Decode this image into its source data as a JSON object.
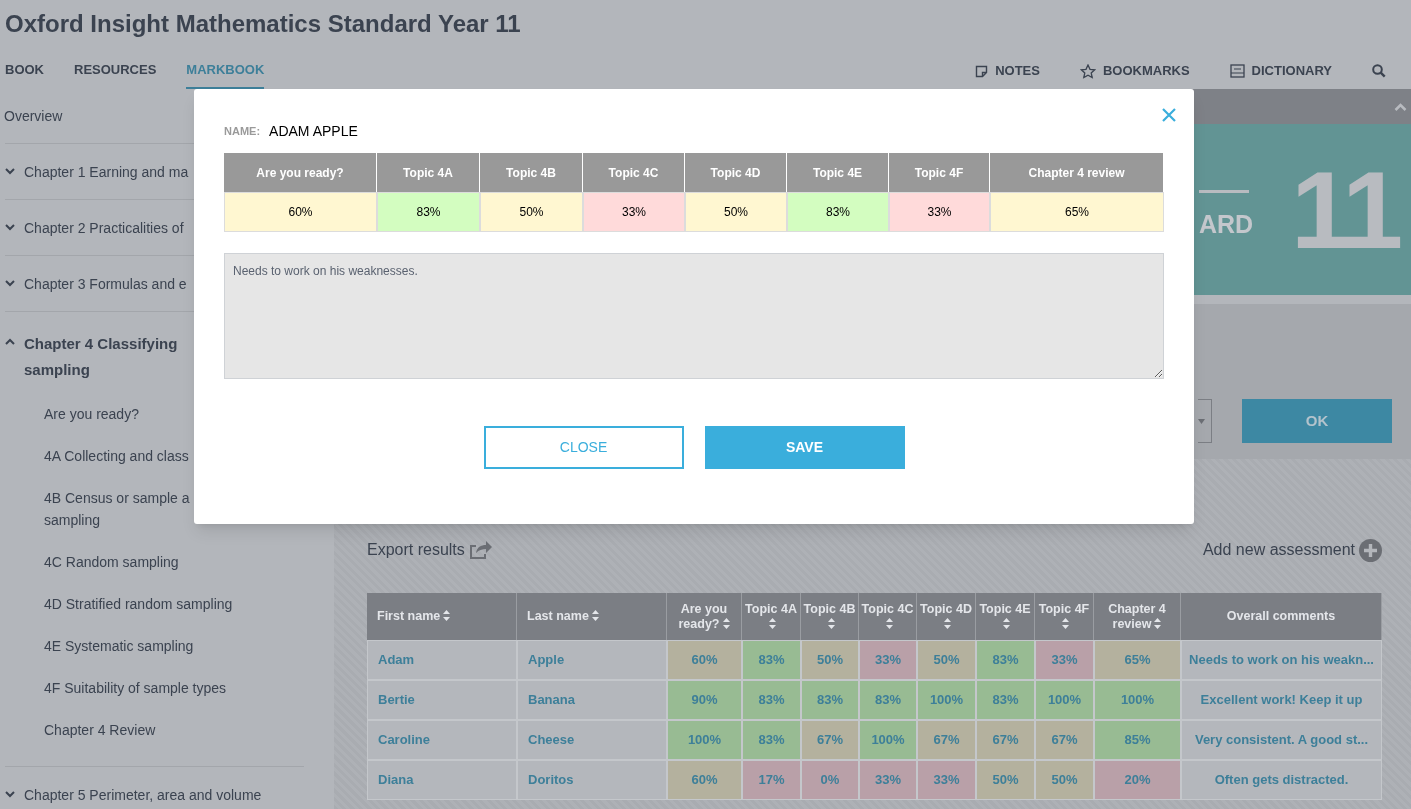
{
  "title": "Oxford Insight Mathematics Standard Year 11",
  "tabs": [
    {
      "label": "BOOK",
      "selected": false
    },
    {
      "label": "RESOURCES",
      "selected": false
    },
    {
      "label": "MARKBOOK",
      "selected": true
    }
  ],
  "tools": [
    {
      "label": "NOTES",
      "kind": "notes"
    },
    {
      "label": "BOOKMARKS",
      "kind": "bookmarks"
    },
    {
      "label": "DICTIONARY",
      "kind": "dictionary"
    }
  ],
  "sidebar": {
    "items": [
      {
        "kind": "link",
        "label": "Overview"
      },
      {
        "kind": "chapter",
        "label": "Chapter 1 Earning and ma",
        "expanded": false
      },
      {
        "kind": "chapter",
        "label": "Chapter 2 Practicalities of",
        "expanded": false
      },
      {
        "kind": "chapter",
        "label": "Chapter 3 Formulas and e",
        "expanded": false
      },
      {
        "kind": "chapter",
        "label": "Chapter 4 Classifying\nsampling",
        "expanded": true,
        "children": [
          {
            "label": "Are you ready?"
          },
          {
            "label": "4A Collecting and class"
          },
          {
            "label": "4B Census or sample a\nsampling"
          },
          {
            "label": "4C Random sampling"
          },
          {
            "label": "4D Stratified random sampling"
          },
          {
            "label": "4E Systematic sampling"
          },
          {
            "label": "4F Suitability of sample types"
          },
          {
            "label": "Chapter 4 Review"
          }
        ]
      },
      {
        "kind": "chapter",
        "label": "Chapter 5 Perimeter, area and volume",
        "expanded": false
      }
    ]
  },
  "cover": {
    "fragment": "ARD",
    "number": "11"
  },
  "ok_button": "OK",
  "markbook": {
    "export_label": "Export results",
    "add_label": "Add new assessment",
    "columns": [
      {
        "label": "First name",
        "kind": "name"
      },
      {
        "label": "Last name",
        "kind": "name"
      },
      {
        "label": "Are you ready?",
        "kind": "score"
      },
      {
        "label": "Topic 4A",
        "kind": "score"
      },
      {
        "label": "Topic 4B",
        "kind": "score"
      },
      {
        "label": "Topic 4C",
        "kind": "score"
      },
      {
        "label": "Topic 4D",
        "kind": "score"
      },
      {
        "label": "Topic 4E",
        "kind": "score"
      },
      {
        "label": "Topic 4F",
        "kind": "score"
      },
      {
        "label": "Chapter 4 review",
        "kind": "score"
      },
      {
        "label": "Overall comments",
        "kind": "comment"
      }
    ],
    "rows": [
      {
        "first": "Adam",
        "last": "Apple",
        "comment": "Needs to work on his weakn...",
        "scores": [
          {
            "value": "60%",
            "color": "#b4b19e"
          },
          {
            "value": "83%",
            "color": "#98bb93"
          },
          {
            "value": "50%",
            "color": "#b4b19e"
          },
          {
            "value": "33%",
            "color": "#b9a0a8"
          },
          {
            "value": "50%",
            "color": "#b4b19e"
          },
          {
            "value": "83%",
            "color": "#98bb93"
          },
          {
            "value": "33%",
            "color": "#b9a0a8"
          },
          {
            "value": "65%",
            "color": "#b4b19e"
          }
        ]
      },
      {
        "first": "Bertie",
        "last": "Banana",
        "comment": "Excellent work! Keep it up",
        "scores": [
          {
            "value": "90%",
            "color": "#98bb93"
          },
          {
            "value": "83%",
            "color": "#98bb93"
          },
          {
            "value": "83%",
            "color": "#98bb93"
          },
          {
            "value": "83%",
            "color": "#98bb93"
          },
          {
            "value": "100%",
            "color": "#98bb93"
          },
          {
            "value": "83%",
            "color": "#98bb93"
          },
          {
            "value": "100%",
            "color": "#98bb93"
          },
          {
            "value": "100%",
            "color": "#98bb93"
          }
        ]
      },
      {
        "first": "Caroline",
        "last": "Cheese",
        "comment": "Very consistent. A good st...",
        "scores": [
          {
            "value": "100%",
            "color": "#98bb93"
          },
          {
            "value": "83%",
            "color": "#98bb93"
          },
          {
            "value": "67%",
            "color": "#b4b19e"
          },
          {
            "value": "100%",
            "color": "#98bb93"
          },
          {
            "value": "67%",
            "color": "#b4b19e"
          },
          {
            "value": "67%",
            "color": "#b4b19e"
          },
          {
            "value": "67%",
            "color": "#b4b19e"
          },
          {
            "value": "85%",
            "color": "#98bb93"
          }
        ]
      },
      {
        "first": "Diana",
        "last": "Doritos",
        "comment": "Often gets distracted.",
        "scores": [
          {
            "value": "60%",
            "color": "#b4b19e"
          },
          {
            "value": "17%",
            "color": "#b9a0a8"
          },
          {
            "value": "0%",
            "color": "#b9a0a8"
          },
          {
            "value": "33%",
            "color": "#b9a0a8"
          },
          {
            "value": "33%",
            "color": "#b9a0a8"
          },
          {
            "value": "50%",
            "color": "#b4b19e"
          },
          {
            "value": "50%",
            "color": "#b4b19e"
          },
          {
            "value": "20%",
            "color": "#b9a0a8"
          }
        ]
      }
    ]
  },
  "modal": {
    "name_label": "NAME:",
    "name": "ADAM APPLE",
    "columns": [
      "Are you ready?",
      "Topic 4A",
      "Topic 4B",
      "Topic 4C",
      "Topic 4D",
      "Topic 4E",
      "Topic 4F",
      "Chapter 4 review"
    ],
    "scores": [
      {
        "value": "60%",
        "color": "#fff7d1"
      },
      {
        "value": "83%",
        "color": "#d3fdc0"
      },
      {
        "value": "50%",
        "color": "#fff7d1"
      },
      {
        "value": "33%",
        "color": "#ffdada"
      },
      {
        "value": "50%",
        "color": "#fff7d1"
      },
      {
        "value": "83%",
        "color": "#d3fdc0"
      },
      {
        "value": "33%",
        "color": "#ffdada"
      },
      {
        "value": "65%",
        "color": "#fff7d1"
      }
    ],
    "comment": "Needs to work on his weaknesses.",
    "buttons": [
      {
        "label": "CLOSE",
        "kind": "outline"
      },
      {
        "label": "SAVE",
        "kind": "filled"
      }
    ]
  }
}
